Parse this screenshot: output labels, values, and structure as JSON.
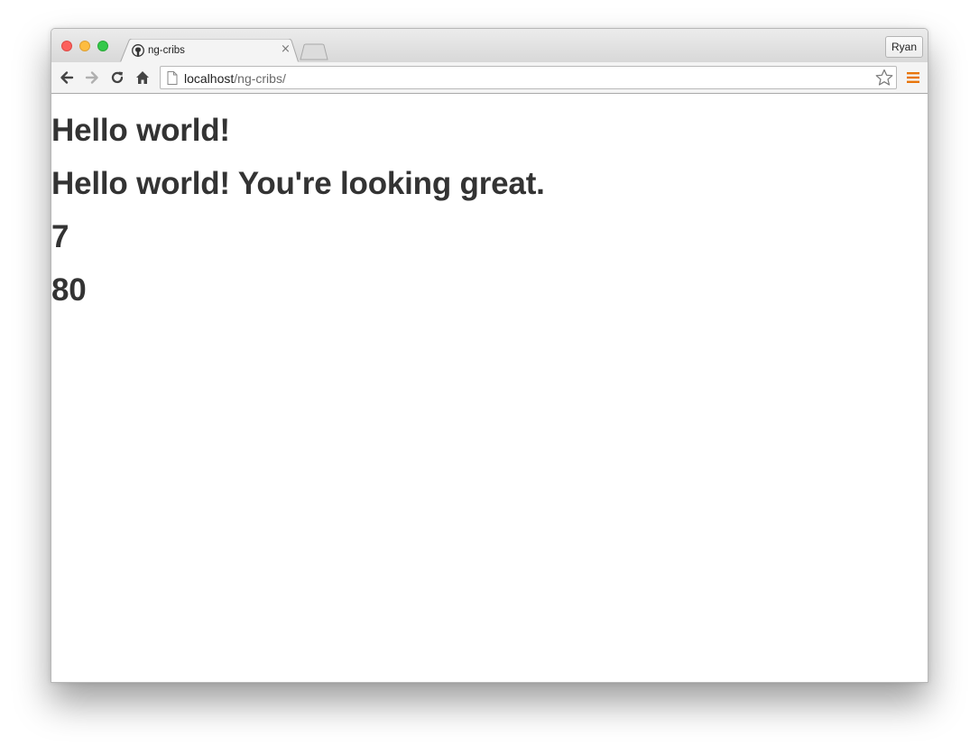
{
  "browser": {
    "tab_title": "ng-cribs",
    "profile_name": "Ryan",
    "url_host": "localhost",
    "url_path": "/ng-cribs/",
    "icons": {
      "back": "back-arrow-icon",
      "forward": "forward-arrow-icon",
      "reload": "reload-icon",
      "home": "home-icon",
      "page": "page-icon",
      "bookmark": "star-icon",
      "menu": "hamburger-menu-icon",
      "favicon": "github-octocat-icon"
    },
    "colors": {
      "close": "#fc605c",
      "minimize": "#fdbc40",
      "maximize": "#34c84a",
      "menu_accent": "#e8750a"
    }
  },
  "page": {
    "headings": [
      "Hello world!",
      "Hello world! You're looking great.",
      "7",
      "80"
    ],
    "text_color": "#333333"
  }
}
